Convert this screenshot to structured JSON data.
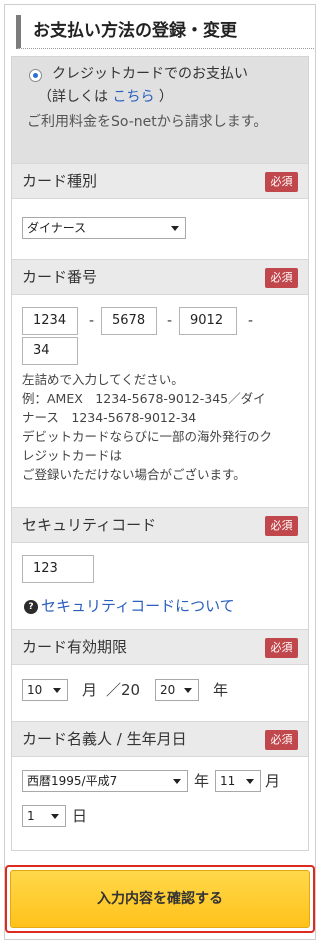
{
  "page": {
    "title": "お支払い方法の登録・変更"
  },
  "payment_method": {
    "option_label": "クレジットカードでのお支払い",
    "detail_prefix": "（詳しくは",
    "detail_link": "こちら",
    "detail_suffix": "）",
    "note": "ご利用料金をSo-netから請求します。"
  },
  "required_badge": "必須",
  "card_type": {
    "label": "カード種別",
    "selected": "ダイナース"
  },
  "card_number": {
    "label": "カード番号",
    "values": [
      "1234",
      "5678",
      "9012",
      "34"
    ],
    "separator": "-",
    "help_lines": [
      "左詰めで入力してください。",
      "例：AMEX　1234-5678-9012-345／ダイ",
      "ナース　1234-5678-9012-34",
      "デビットカードならびに一部の海外発行のク",
      "レジットカードは",
      "ご登録いただけない場合がございます。"
    ]
  },
  "security_code": {
    "label": "セキュリティコード",
    "value": "123",
    "link": "セキュリティコードについて"
  },
  "expiry": {
    "label": "カード有効期限",
    "month": "10",
    "month_unit": "月",
    "year_prefix": "／20",
    "year": "20",
    "year_unit": "年"
  },
  "holder_birth": {
    "label": "カード名義人 / 生年月日",
    "era_year": "西暦1995/平成7",
    "year_unit": "年",
    "month": "11",
    "month_unit": "月",
    "day": "1",
    "day_unit": "日"
  },
  "confirm_button": "入力内容を確認する",
  "colors": {
    "badge": "#c0474b",
    "link": "#2a5fc0",
    "button": "#ffc21a",
    "button_border": "#dd2a1f"
  }
}
